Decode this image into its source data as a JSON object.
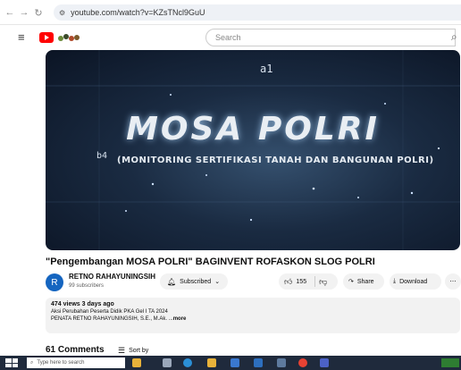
{
  "browser": {
    "url": "youtube.com/watch?v=KZsTNcl9GuU"
  },
  "header": {
    "search_placeholder": "Search"
  },
  "video": {
    "overlay_title": "MOSA POLRI",
    "overlay_subtitle": "(MONITORING SERTIFIKASI TANAH DAN BANGUNAN POLRI)",
    "overlay_b4": "b4",
    "overlay_a1": "a1"
  },
  "title": "\"Pengembangan MOSA POLRI\" BAGINVENT ROFASKON SLOG POLRI",
  "channel": {
    "avatar_letter": "R",
    "name": "RETNO RAHAYUNINGSIH",
    "subscribers": "99 subscribers",
    "subscribed_label": "Subscribed"
  },
  "actions": {
    "likes": "155",
    "share_label": "Share",
    "download_label": "Download"
  },
  "description": {
    "meta": "474 views  3 days ago",
    "line1": "Aksi Perubahan Peserta Didik PKA Gel I TA 2024",
    "line2": "PENATA RETNO RAHAYUNINGSIH, S.E., M.Ak. ...",
    "more": "more"
  },
  "comments": {
    "count_label": "61 Comments",
    "sort_label": "Sort by"
  },
  "taskbar": {
    "search_placeholder": "Type here to search"
  },
  "colors": {
    "youtube_red": "#ff0000",
    "avatar": "#1565c0",
    "taskbar": "#1f2a3c"
  }
}
